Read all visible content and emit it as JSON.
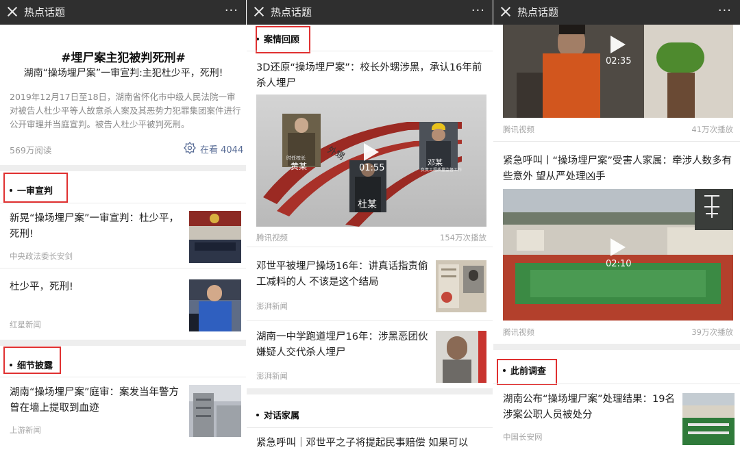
{
  "header_title": "热点话题",
  "header_more": "···",
  "panel1": {
    "hashtag": "#埋尸案主犯被判死刑#",
    "subtitle": "湖南“操场埋尸案”一审宣判:主犯杜少平，死刑!",
    "intro": "2019年12月17日至18日，湖南省怀化市中级人民法院一审对被告人杜少平等人故意杀人案及其恶势力犯罪集团案件进行公开审理并当庭宣判。被告人杜少平被判死刑。",
    "reads": "569万阅读",
    "watching": "在看 4044",
    "section1": "一审宣判",
    "news1_title": "新晃“操场埋尸案”一审宣判：杜少平，死刑!",
    "news1_source": "中央政法委长安剑",
    "news2_title": "杜少平，死刑!",
    "news2_source": "红星新闻",
    "section2": "细节披露",
    "news3_title": "湖南“操场埋尸案”庭审：案发当年警方曾在墙上提取到血迹",
    "news3_source": "上游新闻"
  },
  "panel2": {
    "section1": "案情回顾",
    "video1_title": "3D还原“操场埋尸案”：校长外甥涉黑，承认16年前杀人埋尸",
    "video1_duration": "01:55",
    "video1_label_left": "黄某",
    "video1_label_left_small": "时任校长",
    "video1_label_mid": "杜某",
    "video1_label_right": "邓某",
    "video1_label_right_small": "负责工程质量监督工作",
    "video1_track_text": "外甥",
    "video1_source": "腾讯视频",
    "video1_plays": "154万次播放",
    "news1_title": "邓世平被埋尸操场16年：讲真话指责偷工减料的人 不该是这个结局",
    "news1_source": "澎湃新闻",
    "news2_title": "湖南一中学跑道埋尸16年：涉黑恶团伙嫌疑人交代杀人埋尸",
    "news2_source": "澎湃新闻",
    "section2": "对话家属",
    "news3_title": "紧急呼叫｜邓世平之子将提起民事赔偿 如果可以"
  },
  "panel3": {
    "video1_duration": "02:35",
    "video1_source": "腾讯视频",
    "video1_plays": "41万次播放",
    "video2_title": "紧急呼叫丨“操场埋尸案”受害人家属：牵涉人数多有些意外 望从严处理凶手",
    "video2_duration": "02:10",
    "video2_source": "腾讯视频",
    "video2_plays": "39万次播放",
    "section1": "此前调查",
    "news1_title": "湖南公布“操场埋尸案”处理结果：19名涉案公职人员被处分",
    "news1_source": "中国长安网"
  }
}
